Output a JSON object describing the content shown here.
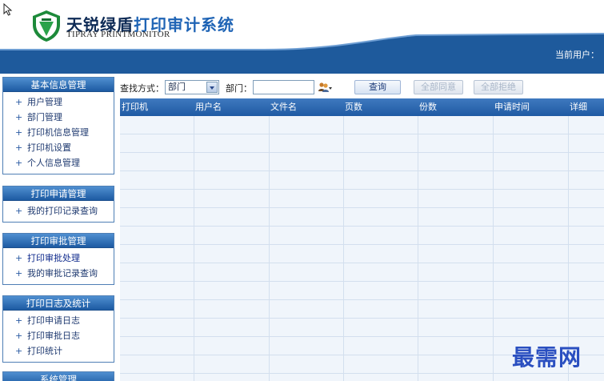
{
  "header": {
    "brand_cn_main": "天锐绿盾",
    "brand_cn_sub": "打印审计系统",
    "brand_en": "TIPRAY PRINTMONITOR",
    "user_label": "当前用户："
  },
  "sidebar": {
    "panels": [
      {
        "title": "基本信息管理",
        "items": [
          "用户管理",
          "部门管理",
          "打印机信息管理",
          "打印机设置",
          "个人信息管理"
        ]
      },
      {
        "title": "打印申请管理",
        "items": [
          "我的打印记录查询"
        ]
      },
      {
        "title": "打印审批管理",
        "items": [
          "打印审批处理",
          "我的审批记录查询"
        ]
      },
      {
        "title": "打印日志及统计",
        "items": [
          "打印申请日志",
          "打印审批日志",
          "打印统计"
        ]
      },
      {
        "title": "系统管理",
        "items": []
      }
    ]
  },
  "toolbar": {
    "search_mode_label": "查找方式：",
    "search_mode_value": "部门",
    "dept_label": "部门：",
    "dept_value": "",
    "query_button": "查询",
    "agree_all_button": "全部同意",
    "reject_all_button": "全部拒绝"
  },
  "table": {
    "columns": [
      "打印机",
      "用户名",
      "文件名",
      "页数",
      "份数",
      "申请时间",
      "详细"
    ],
    "rows": []
  },
  "watermark": "最需网",
  "colors": {
    "banner_blue": "#1e5a9c",
    "header_blue": "#2a64ab",
    "panel_border": "#4f7fb5",
    "grid_bg": "#f0f5fb"
  }
}
